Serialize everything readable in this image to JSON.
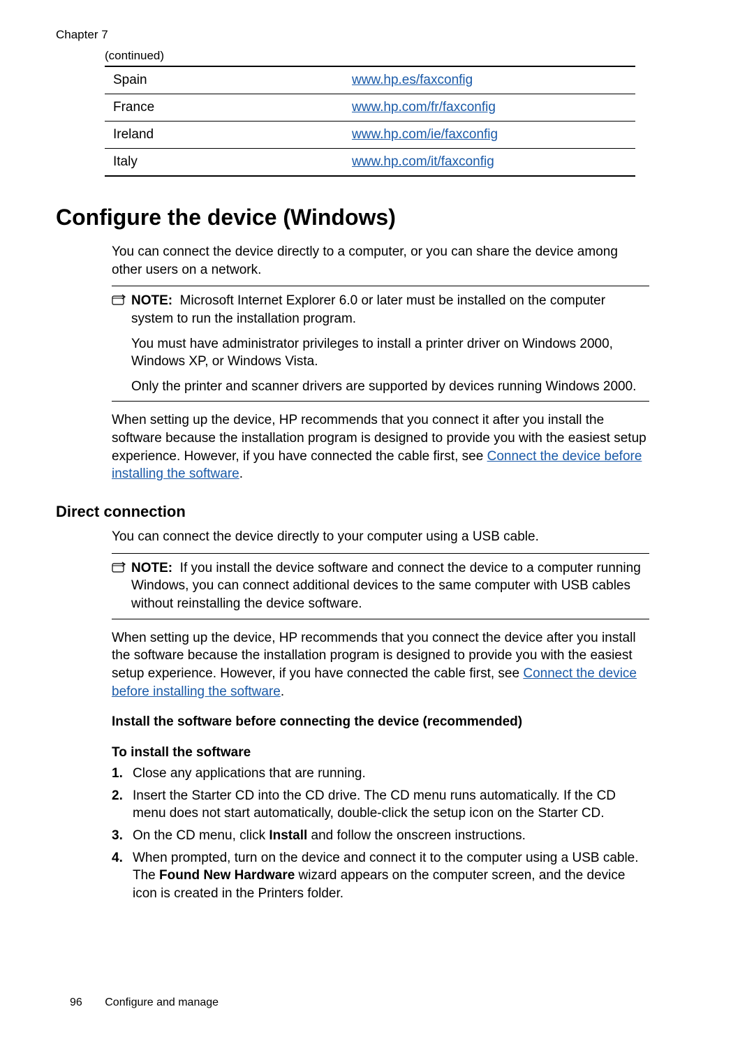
{
  "header": {
    "chapter": "Chapter 7",
    "continued": "(continued)"
  },
  "country_table": [
    {
      "country": "Spain",
      "url": "www.hp.es/faxconfig"
    },
    {
      "country": "France",
      "url": "www.hp.com/fr/faxconfig"
    },
    {
      "country": "Ireland",
      "url": "www.hp.com/ie/faxconfig"
    },
    {
      "country": "Italy",
      "url": "www.hp.com/it/faxconfig"
    }
  ],
  "section": {
    "title": "Configure the device (Windows)",
    "intro": "You can connect the device directly to a computer, or you can share the device among other users on a network.",
    "note1": {
      "label": "NOTE:",
      "p1": "Microsoft Internet Explorer 6.0 or later must be installed on the computer system to run the installation program.",
      "p2": "You must have administrator privileges to install a printer driver on Windows 2000, Windows XP, or Windows Vista.",
      "p3": "Only the printer and scanner drivers are supported by devices running Windows 2000."
    },
    "after_note_p_a": "When setting up the device, HP recommends that you connect it after you install the software because the installation program is designed to provide you with the easiest setup experience. However, if you have connected the cable first, see ",
    "link1": "Connect the device before installing the software",
    "after_note_p_b": "."
  },
  "direct": {
    "title": "Direct connection",
    "intro": "You can connect the device directly to your computer using a USB cable.",
    "note": {
      "label": "NOTE:",
      "p1": "If you install the device software and connect the device to a computer running Windows, you can connect additional devices to the same computer with USB cables without reinstalling the device software."
    },
    "after_note_a": "When setting up the device, HP recommends that you connect the device after you install the software because the installation program is designed to provide you with the easiest setup experience. However, if you have connected the cable first, see ",
    "link1": "Connect the device before installing the software",
    "after_note_b": "."
  },
  "install": {
    "h1": "Install the software before connecting the device (recommended)",
    "h2": "To install the software",
    "steps": {
      "s1": "Close any applications that are running.",
      "s2": "Insert the Starter CD into the CD drive. The CD menu runs automatically. If the CD menu does not start automatically, double-click the setup icon on the Starter CD.",
      "s3_a": "On the CD menu, click ",
      "s3_bold": "Install",
      "s3_b": " and follow the onscreen instructions.",
      "s4_a": "When prompted, turn on the device and connect it to the computer using a USB cable. The ",
      "s4_bold": "Found New Hardware",
      "s4_b": " wizard appears on the computer screen, and the device icon is created in the Printers folder."
    }
  },
  "footer": {
    "page": "96",
    "title": "Configure and manage"
  }
}
